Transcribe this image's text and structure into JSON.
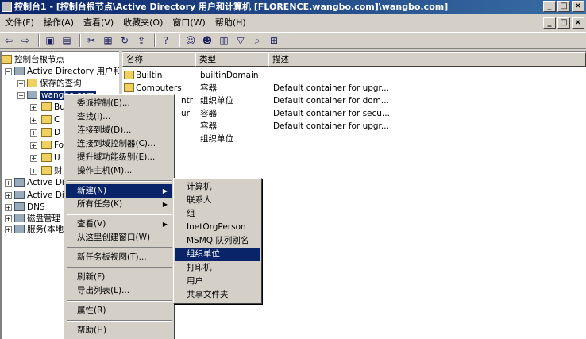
{
  "window": {
    "title": "控制台1 - [控制台根节点\\Active Directory 用户和计算机 [FLORENCE.wangbo.com]\\wangbo.com]",
    "min": "_",
    "max": "□",
    "close": "×"
  },
  "menubar": [
    "文件(F)",
    "操作(A)",
    "查看(V)",
    "收藏夹(O)",
    "窗口(W)",
    "帮助(H)"
  ],
  "mdi_buttons": [
    "_",
    "□",
    "×"
  ],
  "toolbar": {
    "buttons": [
      "back-icon",
      "forward-icon",
      "up-icon",
      "show-hide-tree-icon",
      "cut-icon",
      "properties-icon",
      "refresh-icon",
      "export-icon",
      "help-icon",
      "new-user-icon",
      "new-group-icon",
      "new-ou-icon",
      "filter-icon",
      "find-icon",
      "add-to-group-icon"
    ]
  },
  "tree": {
    "root": "控制台根节点",
    "ad": "Active Directory 用户和计",
    "saved_queries": "保存的查询",
    "domain": "wangbo.com",
    "children_short": [
      "Bu",
      "C",
      "D",
      "Fo",
      "U",
      "财"
    ],
    "ad2": "Active Dir",
    "ad3": "Active Dir",
    "dns": "DNS",
    "disk": "磁盘管理",
    "services": "服务(本地"
  },
  "list": {
    "columns": [
      "名称",
      "类型",
      "描述"
    ],
    "rows": [
      {
        "name": "Builtin",
        "type": "builtinDomain",
        "desc": ""
      },
      {
        "name": "Computers",
        "type": "容器",
        "desc": "Default container for upgr..."
      },
      {
        "name": "",
        "type": "组织单位",
        "desc": "Default container for dom..."
      },
      {
        "name": "",
        "type": "容器",
        "desc": "Default container for secu..."
      },
      {
        "name": "",
        "type": "容器",
        "desc": "Default container for upgr..."
      },
      {
        "name": "",
        "type": "组织单位",
        "desc": ""
      }
    ],
    "partial_names": [
      "ntr",
      "uri"
    ]
  },
  "context_menu": [
    "委派控制(E)...",
    "查找(I)...",
    "连接到域(D)...",
    "连接到域控制器(C)...",
    "提升域功能级别(E)...",
    "操作主机(M)...",
    "新建(N)",
    "所有任务(K)",
    "查看(V)",
    "从这里创建窗口(W)",
    "新任务板视图(T)...",
    "刷新(F)",
    "导出列表(L)...",
    "属性(R)",
    "帮助(H)"
  ],
  "submenu": [
    "计算机",
    "联系人",
    "组",
    "InetOrgPerson",
    "MSMQ 队列别名",
    "组织单位",
    "打印机",
    "用户",
    "共享文件夹"
  ]
}
